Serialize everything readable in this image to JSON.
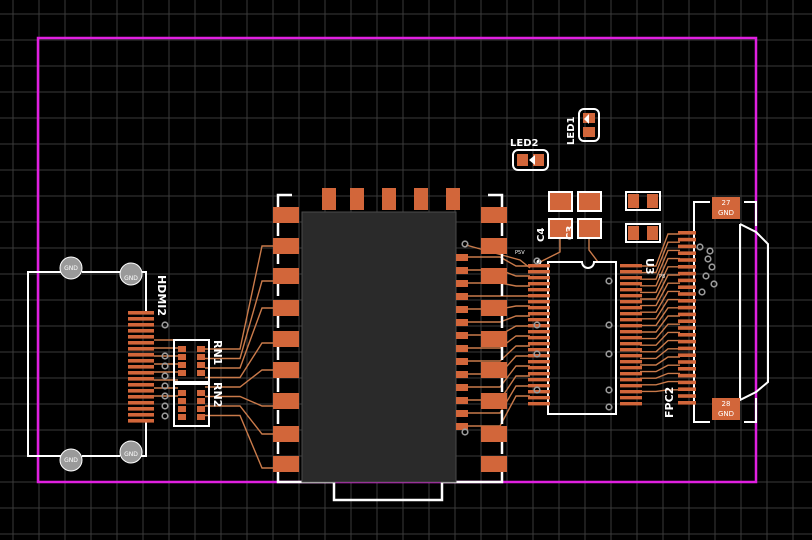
{
  "colors": {
    "background": "#000000",
    "grid": "#3a3a3a",
    "board_outline": "#e020e0",
    "copper_pad": "#d2663a",
    "trace": "#c97a4a",
    "silkscreen": "#ffffff",
    "module_body": "#2a2a2a",
    "via_ring": "#9a9a9a"
  },
  "designators": {
    "hdmi": "HDMI2",
    "rn1": "RN1",
    "rn2": "RN2",
    "c4": "C4",
    "c3": "C3",
    "u3": "U3",
    "led1": "LED1",
    "led2": "LED2",
    "fpc": "FPC2"
  },
  "pad_labels": {
    "fpc_top_num": "27",
    "fpc_top_net": "GND",
    "fpc_bottom_num": "28",
    "fpc_bottom_net": "GND",
    "hdmi_shield_net": "GND",
    "net_p5v": "P5V",
    "net_p8": "P8"
  }
}
